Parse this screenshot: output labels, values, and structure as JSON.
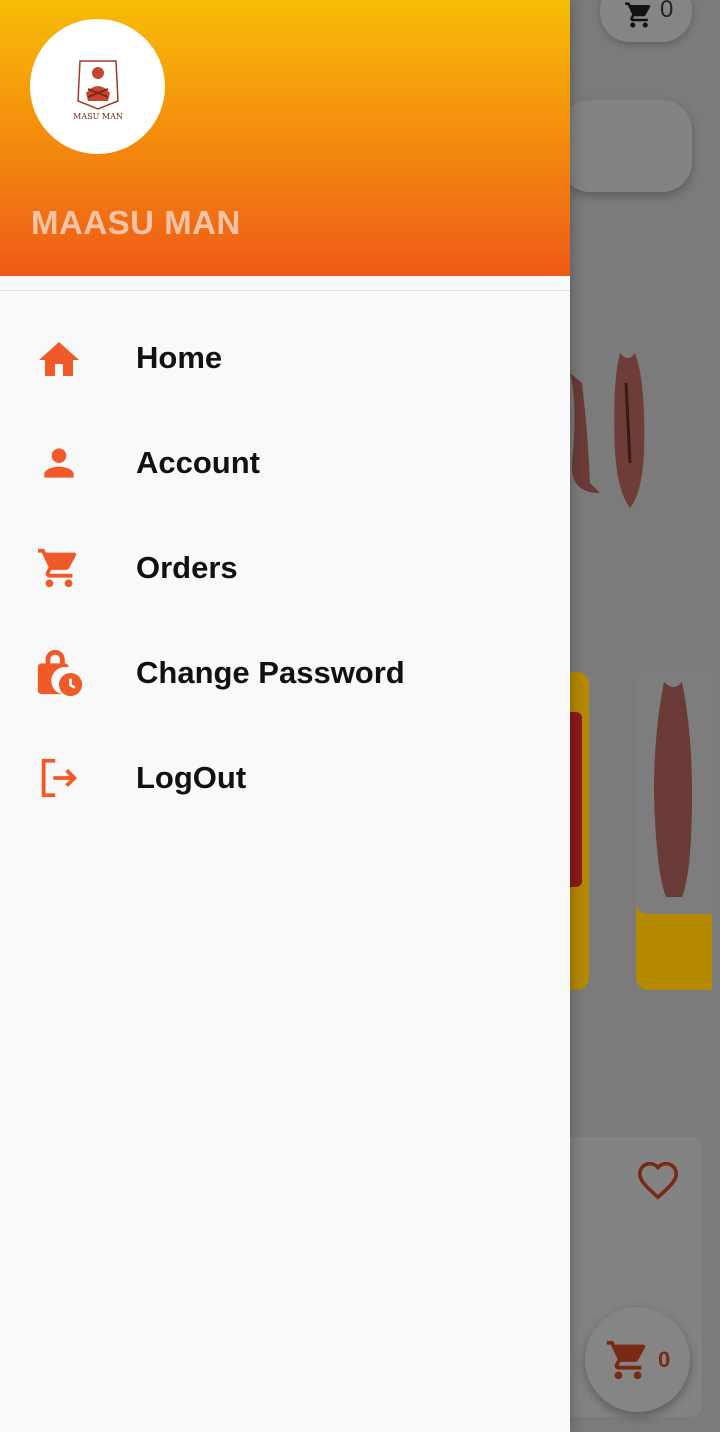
{
  "drawer": {
    "app_name": "MAASU MAN",
    "logo_text": "MASU MAN",
    "menu": [
      {
        "label": "Home",
        "icon": "home-icon"
      },
      {
        "label": "Account",
        "icon": "person-icon"
      },
      {
        "label": "Orders",
        "icon": "cart-icon"
      },
      {
        "label": "Change Password",
        "icon": "lock-clock-icon"
      },
      {
        "label": "LogOut",
        "icon": "logout-icon"
      }
    ]
  },
  "background": {
    "top_cart_count": "0",
    "fab_cart_count": "0"
  },
  "colors": {
    "accent": "#f05a28",
    "header_top": "#f6bd06",
    "header_bottom": "#ee5a18"
  }
}
